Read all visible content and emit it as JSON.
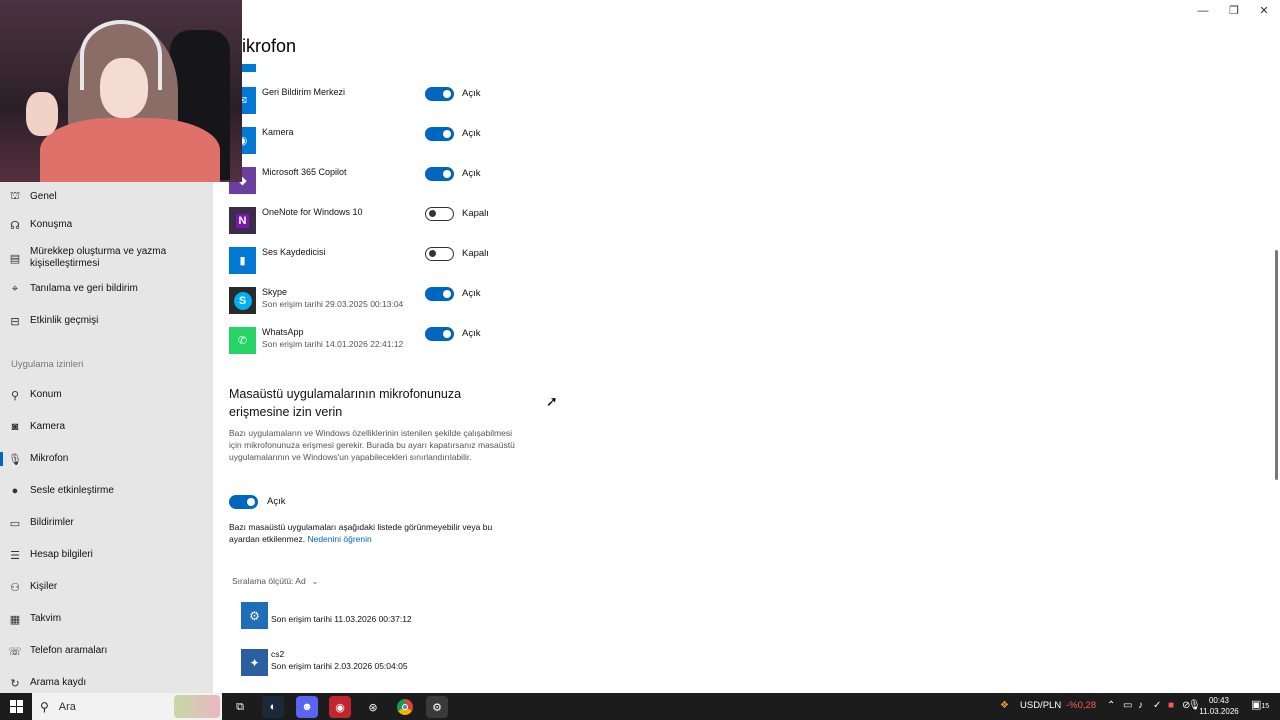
{
  "page": {
    "title": "ikrofon"
  },
  "window_controls": {
    "minimize": "—",
    "restore": "❐",
    "close": "✕"
  },
  "sidebar": {
    "items_top": [
      {
        "label": "Genel",
        "icon": "lock-icon"
      },
      {
        "label": "Konuşma",
        "icon": "speech-icon"
      },
      {
        "label": "Mürekkep oluşturma ve yazma kişiselleştirmesi",
        "icon": "ink-icon"
      },
      {
        "label": "Tanılama ve geri bildirim",
        "icon": "diagnostics-icon"
      },
      {
        "label": "Etkinlik geçmişi",
        "icon": "activity-icon"
      }
    ],
    "section_label": "Uygulama izinleri",
    "items_perm": [
      {
        "label": "Konum",
        "icon": "location-icon"
      },
      {
        "label": "Kamera",
        "icon": "camera-icon"
      },
      {
        "label": "Mikrofon",
        "icon": "microphone-icon",
        "active": true
      },
      {
        "label": "Sesle etkinleştirme",
        "icon": "voice-activation-icon"
      },
      {
        "label": "Bildirimler",
        "icon": "notifications-icon"
      },
      {
        "label": "Hesap bilgileri",
        "icon": "account-info-icon"
      },
      {
        "label": "Kişiler",
        "icon": "contacts-icon"
      },
      {
        "label": "Takvim",
        "icon": "calendar-icon"
      },
      {
        "label": "Telefon aramaları",
        "icon": "phone-icon"
      },
      {
        "label": "Arama kaydı",
        "icon": "call-history-icon"
      }
    ]
  },
  "apps": [
    {
      "name": "Geri Bildirim Merkezi",
      "sub": "",
      "state": "Açık",
      "on": true,
      "color": "#0078d4"
    },
    {
      "name": "Kamera",
      "sub": "",
      "state": "Açık",
      "on": true,
      "color": "#0078d4"
    },
    {
      "name": "Microsoft 365 Copilot",
      "sub": "",
      "state": "Açık",
      "on": true,
      "color": "#6b3fa0"
    },
    {
      "name": "OneNote for Windows 10",
      "sub": "",
      "state": "Kapalı",
      "on": false,
      "color": "#7719aa"
    },
    {
      "name": "Ses Kaydedicisi",
      "sub": "",
      "state": "Kapalı",
      "on": false,
      "color": "#0078d4"
    },
    {
      "name": "Skype",
      "sub": "Son erişim tarihi 29.03.2025 00:13:04",
      "state": "Açık",
      "on": true,
      "color": "#00aff0"
    },
    {
      "name": "WhatsApp",
      "sub": "Son erişim tarihi 14.01.2026 22:41:12",
      "state": "Açık",
      "on": true,
      "color": "#25d366"
    }
  ],
  "desktop": {
    "heading": "Masaüstü uygulamalarının mikrofonunuza erişmesine izin verin",
    "description": "Bazı uygulamaların ve Windows özelliklerinin istenilen şekilde çalışabilmesi için mikrofonunuza erişmesi gerekir. Burada bu ayarı kapatırsanız masaüstü uygulamalarının ve Windows'un yapabilecekleri sınırlandırılabilir.",
    "toggle_label": "Açık",
    "note": "Bazı masaüstü uygulamaları aşağıdaki listede görünmeyebilir veya bu ayardan etkilenmez.",
    "note_link": "Nedenini öğrenin",
    "sort_label": "Sıralama ölçütü: Ad",
    "apps": [
      {
        "name": "",
        "sub": "Son erişim tarihi 11.03.2026 00:37:12",
        "color": "#1e6fb8"
      },
      {
        "name": "cs2",
        "sub": "Son erişim tarihi 2.03.2026 05:04:05",
        "color": "#2b5fa0"
      }
    ]
  },
  "taskbar": {
    "search_placeholder": "Ara",
    "usd": "USD/PLN",
    "usd_change": "-%0,28",
    "time": "00:43",
    "date": "11.03.2026",
    "notif_count": "15",
    "icons": [
      "task-view-icon",
      "steam-icon",
      "discord-icon",
      "app-red-icon",
      "steam-alt-icon",
      "chrome-icon",
      "settings-icon"
    ]
  }
}
